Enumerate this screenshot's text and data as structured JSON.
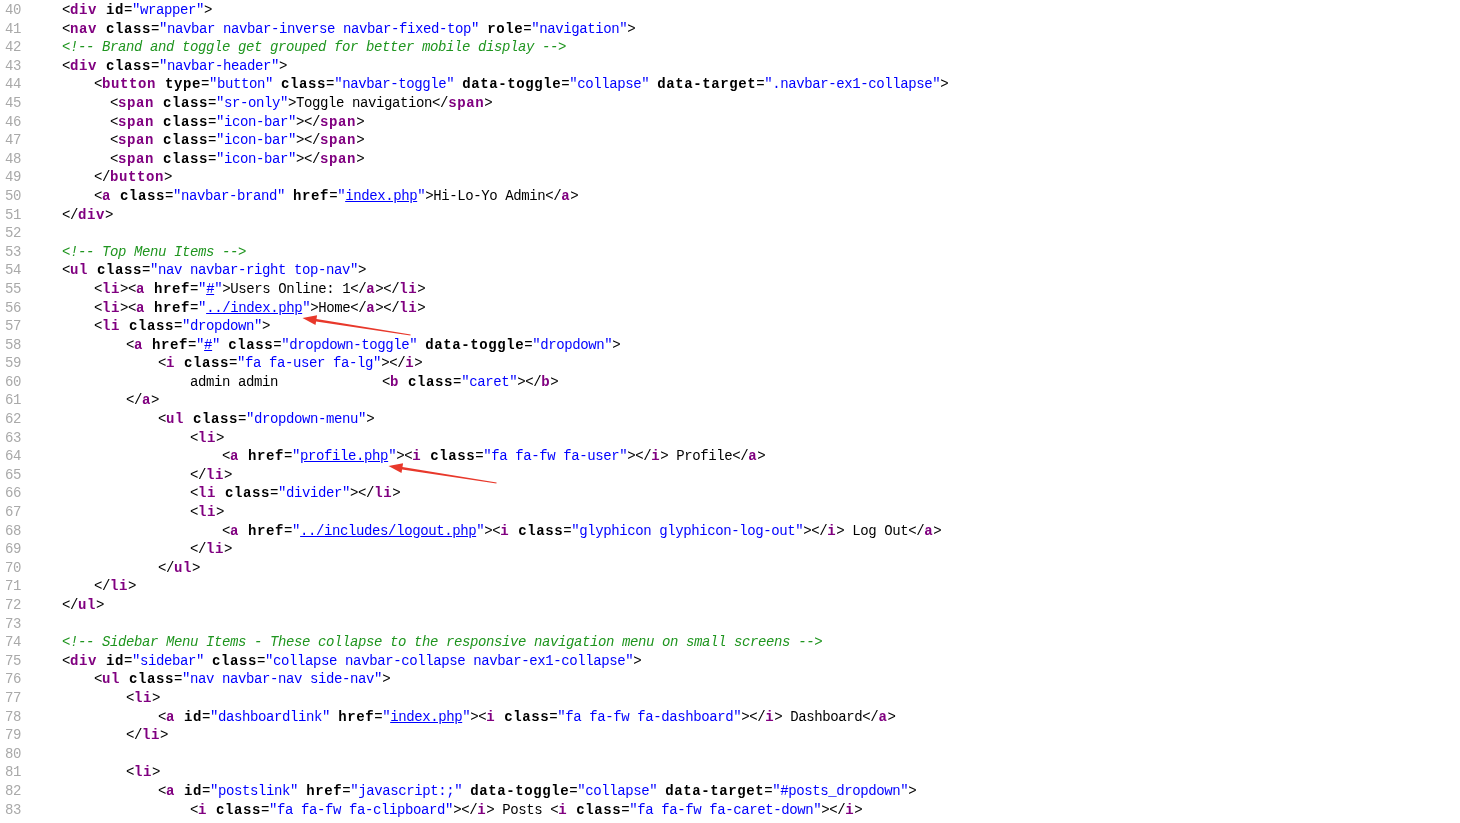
{
  "editor": {
    "lines": [
      {
        "number": "40",
        "tokens": [
          {
            "kind": "plain",
            "text": "<"
          },
          {
            "kind": "tag",
            "text": "div"
          },
          {
            "kind": "attr",
            "text": " id"
          },
          {
            "kind": "plain",
            "text": "="
          },
          {
            "kind": "value",
            "text": "\"wrapper\""
          },
          {
            "kind": "plain",
            "text": ">"
          }
        ]
      },
      {
        "number": "41",
        "tokens": [
          {
            "kind": "plain",
            "text": "<"
          },
          {
            "kind": "tag",
            "text": "nav"
          },
          {
            "kind": "attr",
            "text": " class"
          },
          {
            "kind": "plain",
            "text": "="
          },
          {
            "kind": "value",
            "text": "\"navbar navbar-inverse navbar-fixed-top\" "
          },
          {
            "kind": "attr",
            "text": "role"
          },
          {
            "kind": "plain",
            "text": "="
          },
          {
            "kind": "value",
            "text": "\"navigation\""
          },
          {
            "kind": "plain",
            "text": ">"
          }
        ]
      },
      {
        "number": "42",
        "tokens": [
          {
            "kind": "comment",
            "text": "<!-- Brand and toggle get grouped for better mobile display -->"
          }
        ]
      },
      {
        "number": "43",
        "tokens": [
          {
            "kind": "plain",
            "text": "<"
          },
          {
            "kind": "tag",
            "text": "div"
          },
          {
            "kind": "attr",
            "text": " class"
          },
          {
            "kind": "plain",
            "text": "="
          },
          {
            "kind": "value",
            "text": "\"navbar-header\""
          },
          {
            "kind": "plain",
            "text": ">"
          }
        ]
      },
      {
        "number": "44",
        "tokens": [
          {
            "kind": "plain",
            "text": "    <"
          },
          {
            "kind": "tag",
            "text": "button"
          },
          {
            "kind": "attr",
            "text": " type"
          },
          {
            "kind": "plain",
            "text": "="
          },
          {
            "kind": "value",
            "text": "\"button\" "
          },
          {
            "kind": "attr",
            "text": "class"
          },
          {
            "kind": "plain",
            "text": "="
          },
          {
            "kind": "value",
            "text": "\"navbar-toggle\" "
          },
          {
            "kind": "attr",
            "text": "data-toggle"
          },
          {
            "kind": "plain",
            "text": "="
          },
          {
            "kind": "value",
            "text": "\"collapse\" "
          },
          {
            "kind": "attr",
            "text": "data-target"
          },
          {
            "kind": "plain",
            "text": "="
          },
          {
            "kind": "value",
            "text": "\".navbar-ex1-collapse\""
          },
          {
            "kind": "plain",
            "text": ">"
          }
        ]
      },
      {
        "number": "45",
        "tokens": [
          {
            "kind": "plain",
            "text": "      <"
          },
          {
            "kind": "tag",
            "text": "span"
          },
          {
            "kind": "attr",
            "text": " class"
          },
          {
            "kind": "plain",
            "text": "="
          },
          {
            "kind": "value",
            "text": "\"sr-only\""
          },
          {
            "kind": "plain",
            "text": ">Toggle navigation</"
          },
          {
            "kind": "tag",
            "text": "span"
          },
          {
            "kind": "plain",
            "text": ">"
          }
        ]
      },
      {
        "number": "46",
        "tokens": [
          {
            "kind": "plain",
            "text": "      <"
          },
          {
            "kind": "tag",
            "text": "span"
          },
          {
            "kind": "attr",
            "text": " class"
          },
          {
            "kind": "plain",
            "text": "="
          },
          {
            "kind": "value",
            "text": "\"icon-bar\""
          },
          {
            "kind": "plain",
            "text": "></"
          },
          {
            "kind": "tag",
            "text": "span"
          },
          {
            "kind": "plain",
            "text": ">"
          }
        ]
      },
      {
        "number": "47",
        "tokens": [
          {
            "kind": "plain",
            "text": "      <"
          },
          {
            "kind": "tag",
            "text": "span"
          },
          {
            "kind": "attr",
            "text": " class"
          },
          {
            "kind": "plain",
            "text": "="
          },
          {
            "kind": "value",
            "text": "\"icon-bar\""
          },
          {
            "kind": "plain",
            "text": "></"
          },
          {
            "kind": "tag",
            "text": "span"
          },
          {
            "kind": "plain",
            "text": ">"
          }
        ]
      },
      {
        "number": "48",
        "tokens": [
          {
            "kind": "plain",
            "text": "      <"
          },
          {
            "kind": "tag",
            "text": "span"
          },
          {
            "kind": "attr",
            "text": " class"
          },
          {
            "kind": "plain",
            "text": "="
          },
          {
            "kind": "value",
            "text": "\"icon-bar\""
          },
          {
            "kind": "plain",
            "text": "></"
          },
          {
            "kind": "tag",
            "text": "span"
          },
          {
            "kind": "plain",
            "text": ">"
          }
        ]
      },
      {
        "number": "49",
        "tokens": [
          {
            "kind": "plain",
            "text": "    </"
          },
          {
            "kind": "tag",
            "text": "button"
          },
          {
            "kind": "plain",
            "text": ">"
          }
        ]
      },
      {
        "number": "50",
        "tokens": [
          {
            "kind": "plain",
            "text": "    <"
          },
          {
            "kind": "tag",
            "text": "a"
          },
          {
            "kind": "attr",
            "text": " class"
          },
          {
            "kind": "plain",
            "text": "="
          },
          {
            "kind": "value",
            "text": "\"navbar-brand\" "
          },
          {
            "kind": "attr",
            "text": "href"
          },
          {
            "kind": "plain",
            "text": "="
          },
          {
            "kind": "value",
            "text": "\""
          },
          {
            "kind": "link",
            "text": "index.php",
            "arrow": false
          },
          {
            "kind": "value",
            "text": "\""
          },
          {
            "kind": "plain",
            "text": ">Hi-Lo-Yo Admin</"
          },
          {
            "kind": "tag",
            "text": "a"
          },
          {
            "kind": "plain",
            "text": ">"
          }
        ]
      },
      {
        "number": "51",
        "tokens": [
          {
            "kind": "plain",
            "text": "</"
          },
          {
            "kind": "tag",
            "text": "div"
          },
          {
            "kind": "plain",
            "text": ">"
          }
        ]
      },
      {
        "number": "52"
      },
      {
        "number": "53",
        "tokens": [
          {
            "kind": "comment",
            "text": "<!-- Top Menu Items -->"
          }
        ]
      },
      {
        "number": "54",
        "tokens": [
          {
            "kind": "plain",
            "text": "<"
          },
          {
            "kind": "tag",
            "text": "ul"
          },
          {
            "kind": "attr",
            "text": " class"
          },
          {
            "kind": "plain",
            "text": "="
          },
          {
            "kind": "value",
            "text": "\"nav navbar-right top-nav\""
          },
          {
            "kind": "plain",
            "text": ">"
          }
        ]
      },
      {
        "number": "55",
        "tokens": [
          {
            "kind": "plain",
            "text": "    <"
          },
          {
            "kind": "tag",
            "text": "li"
          },
          {
            "kind": "plain",
            "text": "><"
          },
          {
            "kind": "tag",
            "text": "a"
          },
          {
            "kind": "attr",
            "text": " href"
          },
          {
            "kind": "plain",
            "text": "="
          },
          {
            "kind": "value",
            "text": "\""
          },
          {
            "kind": "link",
            "text": "#",
            "arrow": false
          },
          {
            "kind": "value",
            "text": "\""
          },
          {
            "kind": "plain",
            "text": ">Users Online: 1</"
          },
          {
            "kind": "tag",
            "text": "a"
          },
          {
            "kind": "plain",
            "text": "></"
          },
          {
            "kind": "tag",
            "text": "li"
          },
          {
            "kind": "plain",
            "text": ">"
          }
        ]
      },
      {
        "number": "56",
        "tokens": [
          {
            "kind": "plain",
            "text": "    <"
          },
          {
            "kind": "tag",
            "text": "li"
          },
          {
            "kind": "plain",
            "text": "><"
          },
          {
            "kind": "tag",
            "text": "a"
          },
          {
            "kind": "attr",
            "text": " href"
          },
          {
            "kind": "plain",
            "text": "="
          },
          {
            "kind": "value",
            "text": "\""
          },
          {
            "kind": "link",
            "text": "../index.php",
            "arrow": true
          },
          {
            "kind": "value",
            "text": "\""
          },
          {
            "kind": "plain",
            "text": ">Home</"
          },
          {
            "kind": "tag",
            "text": "a"
          },
          {
            "kind": "plain",
            "text": "></"
          },
          {
            "kind": "tag",
            "text": "li"
          },
          {
            "kind": "plain",
            "text": ">"
          }
        ]
      },
      {
        "number": "57",
        "tokens": [
          {
            "kind": "plain",
            "text": "    <"
          },
          {
            "kind": "tag",
            "text": "li"
          },
          {
            "kind": "attr",
            "text": " class"
          },
          {
            "kind": "plain",
            "text": "="
          },
          {
            "kind": "value",
            "text": "\"dropdown\""
          },
          {
            "kind": "plain",
            "text": ">"
          }
        ]
      },
      {
        "number": "58",
        "tokens": [
          {
            "kind": "plain",
            "text": "        <"
          },
          {
            "kind": "tag",
            "text": "a"
          },
          {
            "kind": "attr",
            "text": " href"
          },
          {
            "kind": "plain",
            "text": "="
          },
          {
            "kind": "value",
            "text": "\""
          },
          {
            "kind": "link",
            "text": "#",
            "arrow": false
          },
          {
            "kind": "value",
            "text": "\" "
          },
          {
            "kind": "attr",
            "text": "class"
          },
          {
            "kind": "plain",
            "text": "="
          },
          {
            "kind": "value",
            "text": "\"dropdown-toggle\" "
          },
          {
            "kind": "attr",
            "text": "data-toggle"
          },
          {
            "kind": "plain",
            "text": "="
          },
          {
            "kind": "value",
            "text": "\"dropdown\""
          },
          {
            "kind": "plain",
            "text": ">"
          }
        ]
      },
      {
        "number": "59",
        "tokens": [
          {
            "kind": "plain",
            "text": "            <"
          },
          {
            "kind": "tag",
            "text": "i"
          },
          {
            "kind": "attr",
            "text": " class"
          },
          {
            "kind": "plain",
            "text": "="
          },
          {
            "kind": "value",
            "text": "\"fa fa-user fa-lg\""
          },
          {
            "kind": "plain",
            "text": "></"
          },
          {
            "kind": "tag",
            "text": "i"
          },
          {
            "kind": "plain",
            "text": ">"
          }
        ]
      },
      {
        "number": "60",
        "tokens": [
          {
            "kind": "plain",
            "text": "                admin admin             <"
          },
          {
            "kind": "tag",
            "text": "b"
          },
          {
            "kind": "attr",
            "text": " class"
          },
          {
            "kind": "plain",
            "text": "="
          },
          {
            "kind": "value",
            "text": "\"caret\""
          },
          {
            "kind": "plain",
            "text": "></"
          },
          {
            "kind": "tag",
            "text": "b"
          },
          {
            "kind": "plain",
            "text": ">"
          }
        ]
      },
      {
        "number": "61",
        "tokens": [
          {
            "kind": "plain",
            "text": "        </"
          },
          {
            "kind": "tag",
            "text": "a"
          },
          {
            "kind": "plain",
            "text": ">"
          }
        ]
      },
      {
        "number": "62",
        "tokens": [
          {
            "kind": "plain",
            "text": "            <"
          },
          {
            "kind": "tag",
            "text": "ul"
          },
          {
            "kind": "attr",
            "text": " class"
          },
          {
            "kind": "plain",
            "text": "="
          },
          {
            "kind": "value",
            "text": "\"dropdown-menu\""
          },
          {
            "kind": "plain",
            "text": ">"
          }
        ]
      },
      {
        "number": "63",
        "tokens": [
          {
            "kind": "plain",
            "text": "                <"
          },
          {
            "kind": "tag",
            "text": "li"
          },
          {
            "kind": "plain",
            "text": ">"
          }
        ]
      },
      {
        "number": "64",
        "tokens": [
          {
            "kind": "plain",
            "text": "                    <"
          },
          {
            "kind": "tag",
            "text": "a"
          },
          {
            "kind": "attr",
            "text": " href"
          },
          {
            "kind": "plain",
            "text": "="
          },
          {
            "kind": "value",
            "text": "\""
          },
          {
            "kind": "link",
            "text": "profile.php",
            "arrow": true
          },
          {
            "kind": "value",
            "text": "\""
          },
          {
            "kind": "plain",
            "text": "><"
          },
          {
            "kind": "tag",
            "text": "i"
          },
          {
            "kind": "attr",
            "text": " class"
          },
          {
            "kind": "plain",
            "text": "="
          },
          {
            "kind": "value",
            "text": "\"fa fa-fw fa-user\""
          },
          {
            "kind": "plain",
            "text": "></"
          },
          {
            "kind": "tag",
            "text": "i"
          },
          {
            "kind": "plain",
            "text": "> Profile</"
          },
          {
            "kind": "tag",
            "text": "a"
          },
          {
            "kind": "plain",
            "text": ">"
          }
        ]
      },
      {
        "number": "65",
        "tokens": [
          {
            "kind": "plain",
            "text": "                </"
          },
          {
            "kind": "tag",
            "text": "li"
          },
          {
            "kind": "plain",
            "text": ">"
          }
        ]
      },
      {
        "number": "66",
        "tokens": [
          {
            "kind": "plain",
            "text": "                <"
          },
          {
            "kind": "tag",
            "text": "li"
          },
          {
            "kind": "attr",
            "text": " class"
          },
          {
            "kind": "plain",
            "text": "="
          },
          {
            "kind": "value",
            "text": "\"divider\""
          },
          {
            "kind": "plain",
            "text": "></"
          },
          {
            "kind": "tag",
            "text": "li"
          },
          {
            "kind": "plain",
            "text": ">"
          }
        ]
      },
      {
        "number": "67",
        "tokens": [
          {
            "kind": "plain",
            "text": "                <"
          },
          {
            "kind": "tag",
            "text": "li"
          },
          {
            "kind": "plain",
            "text": ">"
          }
        ]
      },
      {
        "number": "68",
        "tokens": [
          {
            "kind": "plain",
            "text": "                    <"
          },
          {
            "kind": "tag",
            "text": "a"
          },
          {
            "kind": "attr",
            "text": " href"
          },
          {
            "kind": "plain",
            "text": "="
          },
          {
            "kind": "value",
            "text": "\""
          },
          {
            "kind": "link",
            "text": "../includes/logout.php",
            "arrow": false
          },
          {
            "kind": "value",
            "text": "\""
          },
          {
            "kind": "plain",
            "text": "><"
          },
          {
            "kind": "tag",
            "text": "i"
          },
          {
            "kind": "attr",
            "text": " class"
          },
          {
            "kind": "plain",
            "text": "="
          },
          {
            "kind": "value",
            "text": "\"glyphicon glyphicon-log-out\""
          },
          {
            "kind": "plain",
            "text": "></"
          },
          {
            "kind": "tag",
            "text": "i"
          },
          {
            "kind": "plain",
            "text": "> Log Out</"
          },
          {
            "kind": "tag",
            "text": "a"
          },
          {
            "kind": "plain",
            "text": ">"
          }
        ]
      },
      {
        "number": "69",
        "tokens": [
          {
            "kind": "plain",
            "text": "                </"
          },
          {
            "kind": "tag",
            "text": "li"
          },
          {
            "kind": "plain",
            "text": ">"
          }
        ]
      },
      {
        "number": "70",
        "tokens": [
          {
            "kind": "plain",
            "text": "            </"
          },
          {
            "kind": "tag",
            "text": "ul"
          },
          {
            "kind": "plain",
            "text": ">"
          }
        ]
      },
      {
        "number": "71",
        "tokens": [
          {
            "kind": "plain",
            "text": "    </"
          },
          {
            "kind": "tag",
            "text": "li"
          },
          {
            "kind": "plain",
            "text": ">"
          }
        ]
      },
      {
        "number": "72",
        "tokens": [
          {
            "kind": "plain",
            "text": "</"
          },
          {
            "kind": "tag",
            "text": "ul"
          },
          {
            "kind": "plain",
            "text": ">"
          }
        ]
      },
      {
        "number": "73"
      },
      {
        "number": "74",
        "tokens": [
          {
            "kind": "comment",
            "text": "<!-- Sidebar Menu Items - These collapse to the responsive navigation menu on small screens -->"
          }
        ]
      },
      {
        "number": "75",
        "tokens": [
          {
            "kind": "plain",
            "text": "<"
          },
          {
            "kind": "tag",
            "text": "div"
          },
          {
            "kind": "attr",
            "text": " id"
          },
          {
            "kind": "plain",
            "text": "="
          },
          {
            "kind": "value",
            "text": "\"sidebar\" "
          },
          {
            "kind": "attr",
            "text": "class"
          },
          {
            "kind": "plain",
            "text": "="
          },
          {
            "kind": "value",
            "text": "\"collapse navbar-collapse navbar-ex1-collapse\""
          },
          {
            "kind": "plain",
            "text": ">"
          }
        ]
      },
      {
        "number": "76",
        "tokens": [
          {
            "kind": "plain",
            "text": "    <"
          },
          {
            "kind": "tag",
            "text": "ul"
          },
          {
            "kind": "attr",
            "text": " class"
          },
          {
            "kind": "plain",
            "text": "="
          },
          {
            "kind": "value",
            "text": "\"nav navbar-nav side-nav\""
          },
          {
            "kind": "plain",
            "text": ">"
          }
        ]
      },
      {
        "number": "77",
        "tokens": [
          {
            "kind": "plain",
            "text": "        <"
          },
          {
            "kind": "tag",
            "text": "li"
          },
          {
            "kind": "plain",
            "text": ">"
          }
        ]
      },
      {
        "number": "78",
        "tokens": [
          {
            "kind": "plain",
            "text": "            <"
          },
          {
            "kind": "tag",
            "text": "a"
          },
          {
            "kind": "attr",
            "text": " id"
          },
          {
            "kind": "plain",
            "text": "="
          },
          {
            "kind": "value",
            "text": "\"dashboardlink\" "
          },
          {
            "kind": "attr",
            "text": "href"
          },
          {
            "kind": "plain",
            "text": "="
          },
          {
            "kind": "value",
            "text": "\""
          },
          {
            "kind": "link",
            "text": "index.php",
            "arrow": false
          },
          {
            "kind": "value",
            "text": "\""
          },
          {
            "kind": "plain",
            "text": "><"
          },
          {
            "kind": "tag",
            "text": "i"
          },
          {
            "kind": "attr",
            "text": " class"
          },
          {
            "kind": "plain",
            "text": "="
          },
          {
            "kind": "value",
            "text": "\"fa fa-fw fa-dashboard\""
          },
          {
            "kind": "plain",
            "text": "></"
          },
          {
            "kind": "tag",
            "text": "i"
          },
          {
            "kind": "plain",
            "text": "> Dashboard</"
          },
          {
            "kind": "tag",
            "text": "a"
          },
          {
            "kind": "plain",
            "text": ">"
          }
        ]
      },
      {
        "number": "79",
        "tokens": [
          {
            "kind": "plain",
            "text": "        </"
          },
          {
            "kind": "tag",
            "text": "li"
          },
          {
            "kind": "plain",
            "text": ">"
          }
        ]
      },
      {
        "number": "80"
      },
      {
        "number": "81",
        "tokens": [
          {
            "kind": "plain",
            "text": "        <"
          },
          {
            "kind": "tag",
            "text": "li"
          },
          {
            "kind": "plain",
            "text": ">"
          }
        ]
      },
      {
        "number": "82",
        "tokens": [
          {
            "kind": "plain",
            "text": "            <"
          },
          {
            "kind": "tag",
            "text": "a"
          },
          {
            "kind": "attr",
            "text": " id"
          },
          {
            "kind": "plain",
            "text": "="
          },
          {
            "kind": "value",
            "text": "\"postslink\" "
          },
          {
            "kind": "attr",
            "text": "href"
          },
          {
            "kind": "plain",
            "text": "="
          },
          {
            "kind": "value",
            "text": "\"javascript:;\" "
          },
          {
            "kind": "attr",
            "text": "data-toggle"
          },
          {
            "kind": "plain",
            "text": "="
          },
          {
            "kind": "value",
            "text": "\"collapse\" "
          },
          {
            "kind": "attr",
            "text": "data-target"
          },
          {
            "kind": "plain",
            "text": "="
          },
          {
            "kind": "value",
            "text": "\"#posts_dropdown\""
          },
          {
            "kind": "plain",
            "text": ">"
          }
        ]
      },
      {
        "number": "83",
        "tokens": [
          {
            "kind": "plain",
            "text": "                <"
          },
          {
            "kind": "tag",
            "text": "i"
          },
          {
            "kind": "attr",
            "text": " class"
          },
          {
            "kind": "plain",
            "text": "="
          },
          {
            "kind": "value",
            "text": "\"fa fa-fw fa-clipboard\""
          },
          {
            "kind": "plain",
            "text": "></"
          },
          {
            "kind": "tag",
            "text": "i"
          },
          {
            "kind": "plain",
            "text": "> Posts <"
          },
          {
            "kind": "tag",
            "text": "i"
          },
          {
            "kind": "attr",
            "text": " class"
          },
          {
            "kind": "plain",
            "text": "="
          },
          {
            "kind": "value",
            "text": "\"fa fa-fw fa-caret-down\""
          },
          {
            "kind": "plain",
            "text": "></"
          },
          {
            "kind": "tag",
            "text": "i"
          },
          {
            "kind": "plain",
            "text": ">"
          }
        ]
      }
    ]
  }
}
